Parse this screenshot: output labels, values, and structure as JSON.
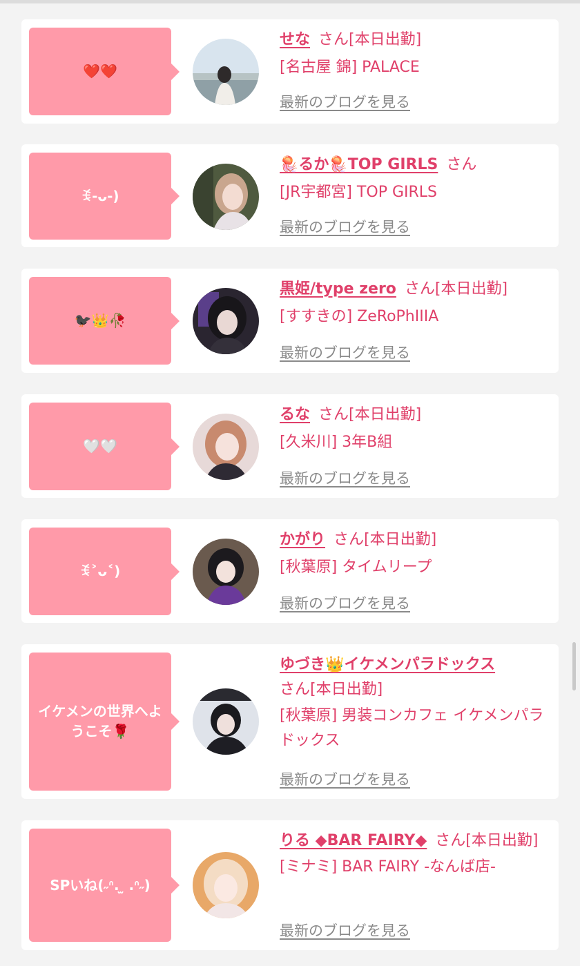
{
  "blog_link_label": "最新のブログを見る",
  "colors": {
    "accent": "#e0406a",
    "bubble": "#ff9aa9",
    "link_gray": "#8a8a8a",
    "background": "#f3f3f3"
  },
  "entries": [
    {
      "comment": "❤️❤️",
      "name": "せな",
      "suffix": "さん[本日出勤]",
      "shop": "[名古屋 錦] PALACE",
      "avatar_icon": "avatar-photo"
    },
    {
      "comment": "ꉂ-ᴗ-)",
      "name": "🪼るか🪼TOP GIRLS",
      "suffix": "さん",
      "shop": "[JR宇都宮] TOP GIRLS",
      "avatar_icon": "avatar-photo"
    },
    {
      "comment": "🐦‍⬛👑🥀",
      "name": "黒姫/type zero",
      "suffix": "さん[本日出勤]",
      "shop": "[すすきの] ZeRoPhIIIA",
      "avatar_icon": "avatar-photo"
    },
    {
      "comment": "🤍🤍",
      "name": "るな",
      "suffix": "さん[本日出勤]",
      "shop": "[久米川] 3年B組",
      "avatar_icon": "avatar-photo"
    },
    {
      "comment": "ꉂ˃ᴗ˂)",
      "name": "かがり",
      "suffix": "さん[本日出勤]",
      "shop": "[秋葉原] タイムリープ",
      "avatar_icon": "avatar-photo"
    },
    {
      "comment": "イケメンの世界へようこそ🌹",
      "name": "ゆづき👑イケメンパラドックス",
      "suffix": "さん[本日出勤]",
      "shop": "[秋葉原] 男装コンカフェ イケメンパラドックス",
      "avatar_icon": "avatar-photo"
    },
    {
      "comment": "SPいね(˶ᐢ. ̫ .ᐢ˶)",
      "name": "りる ◆BAR FAIRY◆",
      "suffix": "さん[本日出勤]",
      "shop": "[ミナミ] BAR FAIRY -なんば店-",
      "avatar_icon": "avatar-photo"
    }
  ]
}
